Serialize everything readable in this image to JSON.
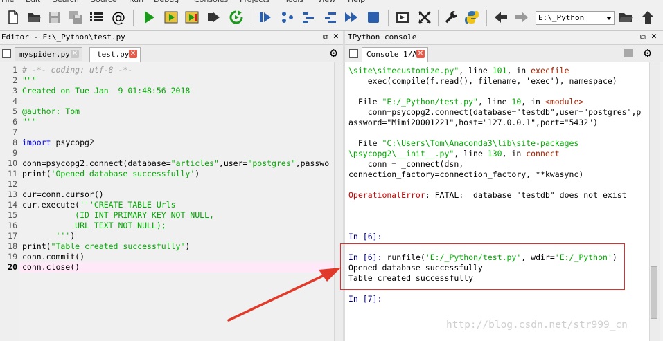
{
  "menubar": {
    "items": [
      "File",
      "Edit",
      "Search",
      "Source",
      "Run",
      "Debug",
      "Consoles",
      "Projects",
      "Tools",
      "View",
      "Help"
    ]
  },
  "toolbar": {
    "working_dir": "E:\\_Python",
    "icons": [
      "new-file-icon",
      "open-folder-icon",
      "save-icon",
      "save-all-icon",
      "outline-icon",
      "at-icon",
      "run-icon",
      "run-cell-icon",
      "run-cell-advance-icon",
      "run-selection-icon",
      "rerun-icon",
      "debug-icon",
      "step-icon",
      "step-into-icon",
      "step-return-icon",
      "continue-icon",
      "stop-icon",
      "maximize-pane-icon",
      "fullscreen-icon",
      "wrench-icon",
      "python-icon",
      "back-arrow-icon",
      "forward-arrow-icon",
      "browse-folder-icon",
      "parent-dir-icon"
    ]
  },
  "editor": {
    "title": "Editor - E:\\_Python\\test.py",
    "tabs": [
      {
        "label": "myspider.py",
        "active": false
      },
      {
        "label": "test.py",
        "active": true
      }
    ],
    "current_line": 20,
    "lines": [
      {
        "n": "1",
        "parts": [
          {
            "t": "# -*- coding: utf-8 -*-",
            "c": "cmt"
          }
        ]
      },
      {
        "n": "2",
        "parts": [
          {
            "t": "\"\"\"",
            "c": "doc"
          }
        ]
      },
      {
        "n": "3",
        "parts": [
          {
            "t": "Created on Tue Jan  9 01:48:56 2018",
            "c": "doc"
          }
        ]
      },
      {
        "n": "4",
        "parts": []
      },
      {
        "n": "5",
        "parts": [
          {
            "t": "@author: Tom",
            "c": "doc"
          }
        ]
      },
      {
        "n": "6",
        "parts": [
          {
            "t": "\"\"\"",
            "c": "doc"
          }
        ]
      },
      {
        "n": "7",
        "parts": []
      },
      {
        "n": "8",
        "parts": [
          {
            "t": "import",
            "c": "kw"
          },
          {
            "t": " psycopg2",
            "c": ""
          }
        ]
      },
      {
        "n": "9",
        "parts": []
      },
      {
        "n": "10",
        "parts": [
          {
            "t": "conn=psycopg2.connect(database=",
            "c": ""
          },
          {
            "t": "\"articles\"",
            "c": "str"
          },
          {
            "t": ",user=",
            "c": ""
          },
          {
            "t": "\"postgres\"",
            "c": "str"
          },
          {
            "t": ",passwo",
            "c": ""
          }
        ]
      },
      {
        "n": "11",
        "parts": [
          {
            "t": "print(",
            "c": ""
          },
          {
            "t": "'Opened database successfully'",
            "c": "str"
          },
          {
            "t": ")",
            "c": ""
          }
        ]
      },
      {
        "n": "12",
        "parts": []
      },
      {
        "n": "13",
        "parts": [
          {
            "t": "cur=conn.cursor()",
            "c": ""
          }
        ]
      },
      {
        "n": "14",
        "parts": [
          {
            "t": "cur.execute(",
            "c": ""
          },
          {
            "t": "'''CREATE TABLE Urls",
            "c": "str"
          }
        ]
      },
      {
        "n": "15",
        "parts": [
          {
            "t": "           (ID INT PRIMARY KEY NOT NULL,",
            "c": "str"
          }
        ]
      },
      {
        "n": "16",
        "parts": [
          {
            "t": "           URL TEXT NOT NULL);",
            "c": "str"
          }
        ]
      },
      {
        "n": "17",
        "parts": [
          {
            "t": "       '''",
            "c": "str"
          },
          {
            "t": ")",
            "c": ""
          }
        ]
      },
      {
        "n": "18",
        "parts": [
          {
            "t": "print(",
            "c": ""
          },
          {
            "t": "\"Table created successfully\"",
            "c": "str"
          },
          {
            "t": ")",
            "c": ""
          }
        ]
      },
      {
        "n": "19",
        "parts": [
          {
            "t": "conn.commit()",
            "c": ""
          }
        ]
      },
      {
        "n": "20",
        "parts": [
          {
            "t": "conn.close()",
            "c": ""
          }
        ]
      }
    ]
  },
  "console": {
    "title": "IPython console",
    "tab_label": "Console 1/A",
    "lines": [
      {
        "parts": [
          {
            "t": "\\site\\sitecustomize.py\"",
            "c": "green"
          },
          {
            "t": ", line ",
            "c": ""
          },
          {
            "t": "101",
            "c": "green"
          },
          {
            "t": ", in ",
            "c": ""
          },
          {
            "t": "execfile",
            "c": "darkred"
          }
        ]
      },
      {
        "parts": [
          {
            "t": "    exec(compile(f.read(), filename, 'exec'), namespace)",
            "c": ""
          }
        ]
      },
      {
        "parts": []
      },
      {
        "parts": [
          {
            "t": "  File ",
            "c": ""
          },
          {
            "t": "\"E:/_Python/test.py\"",
            "c": "green"
          },
          {
            "t": ", line ",
            "c": ""
          },
          {
            "t": "10",
            "c": "green"
          },
          {
            "t": ", in ",
            "c": ""
          },
          {
            "t": "<module>",
            "c": "darkred"
          }
        ]
      },
      {
        "parts": [
          {
            "t": "    conn=psycopg2.connect(database=\"testdb\",user=\"postgres\",p",
            "c": ""
          }
        ]
      },
      {
        "parts": [
          {
            "t": "assword=\"Mimi20001221\",host=\"127.0.0.1\",port=\"5432\")",
            "c": ""
          }
        ]
      },
      {
        "parts": []
      },
      {
        "parts": [
          {
            "t": "  File ",
            "c": ""
          },
          {
            "t": "\"C:\\Users\\Tom\\Anaconda3\\lib\\site-packages",
            "c": "green"
          }
        ]
      },
      {
        "parts": [
          {
            "t": "\\psycopg2\\__init__.py\"",
            "c": "green"
          },
          {
            "t": ", line ",
            "c": ""
          },
          {
            "t": "130",
            "c": "green"
          },
          {
            "t": ", in ",
            "c": ""
          },
          {
            "t": "connect",
            "c": "darkred"
          }
        ]
      },
      {
        "parts": [
          {
            "t": "    conn = _connect(dsn,",
            "c": ""
          }
        ]
      },
      {
        "parts": [
          {
            "t": "connection_factory=connection_factory, **kwasync)",
            "c": ""
          }
        ]
      },
      {
        "parts": []
      },
      {
        "parts": [
          {
            "t": "OperationalError",
            "c": "red"
          },
          {
            "t": ": FATAL:  database \"testdb\" does not exist",
            "c": ""
          }
        ]
      },
      {
        "parts": []
      },
      {
        "parts": []
      },
      {
        "parts": []
      },
      {
        "parts": [
          {
            "t": "In [",
            "c": "prompt"
          },
          {
            "t": "6",
            "c": "prompt"
          },
          {
            "t": "]:",
            "c": "prompt"
          }
        ]
      },
      {
        "parts": []
      },
      {
        "parts": [
          {
            "t": "In [",
            "c": "prompt"
          },
          {
            "t": "6",
            "c": "prompt"
          },
          {
            "t": "]: ",
            "c": "prompt"
          },
          {
            "t": "runfile(",
            "c": ""
          },
          {
            "t": "'E:/_Python/test.py'",
            "c": "green"
          },
          {
            "t": ", wdir=",
            "c": ""
          },
          {
            "t": "'E:/_Python'",
            "c": "green"
          },
          {
            "t": ")",
            "c": ""
          }
        ]
      },
      {
        "parts": [
          {
            "t": "Opened database successfully",
            "c": ""
          }
        ]
      },
      {
        "parts": [
          {
            "t": "Table created successfully",
            "c": ""
          }
        ]
      },
      {
        "parts": []
      },
      {
        "parts": [
          {
            "t": "In [",
            "c": "prompt"
          },
          {
            "t": "7",
            "c": "prompt"
          },
          {
            "t": "]:",
            "c": "prompt"
          }
        ]
      }
    ]
  },
  "watermark": "http://blog.csdn.net/str999_cn"
}
